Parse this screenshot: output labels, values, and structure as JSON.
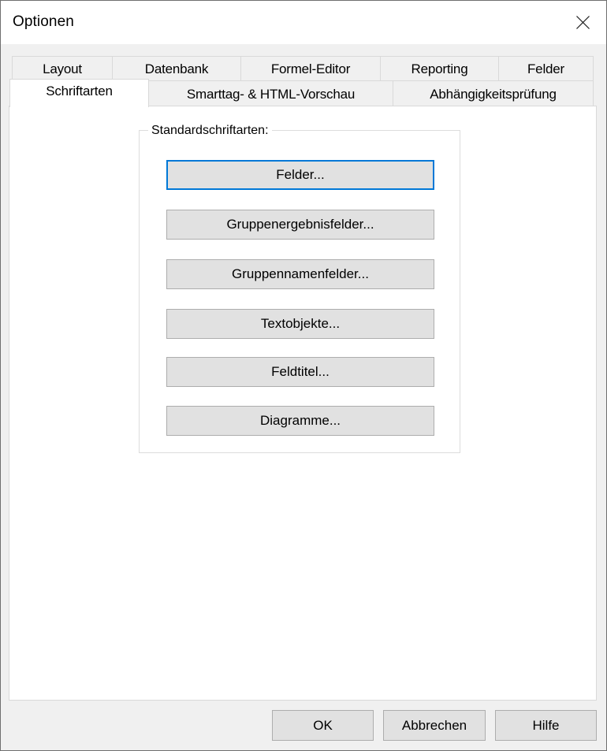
{
  "window": {
    "title": "Optionen",
    "close_icon": "close-icon"
  },
  "tabs": {
    "row_top": [
      {
        "label": "Layout"
      },
      {
        "label": "Datenbank"
      },
      {
        "label": "Formel-Editor"
      },
      {
        "label": "Reporting"
      },
      {
        "label": "Felder"
      }
    ],
    "row_bottom": [
      {
        "label": "Schriftarten",
        "active": true
      },
      {
        "label": "Smarttag- & HTML-Vorschau"
      },
      {
        "label": "Abhängigkeitsprüfung"
      }
    ]
  },
  "group": {
    "label": "Standardschriftarten:",
    "buttons": [
      {
        "label": "Felder...",
        "focused": true
      },
      {
        "label": "Gruppenergebnisfelder..."
      },
      {
        "label": "Gruppennamenfelder..."
      },
      {
        "label": "Textobjekte..."
      },
      {
        "label": "Feldtitel..."
      },
      {
        "label": "Diagramme..."
      }
    ]
  },
  "footer": {
    "ok_label": "OK",
    "cancel_label": "Abbrechen",
    "help_label": "Hilfe"
  },
  "colors": {
    "focus_accent": "#0078d7",
    "button_face": "#e1e1e1",
    "dialog_bg": "#f0f0f0"
  }
}
